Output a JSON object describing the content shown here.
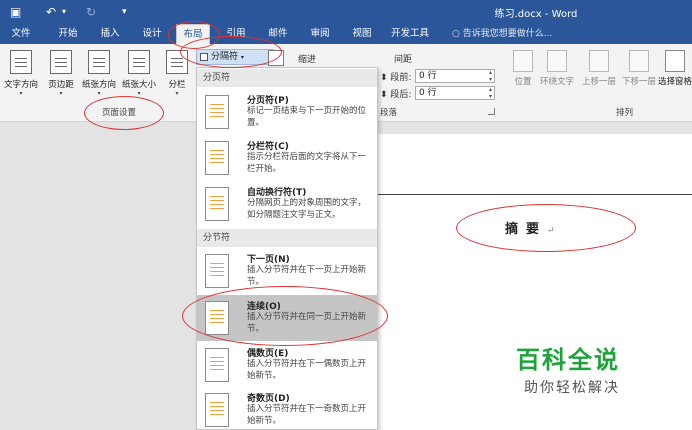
{
  "titlebar": {
    "save_icon": "save-icon",
    "undo_icon": "undo-icon",
    "redo_icon": "redo-icon",
    "customize_icon": "customize-icon",
    "title": "练习.docx - Word"
  },
  "tabs": [
    "文件",
    "开始",
    "插入",
    "设计",
    "布局",
    "引用",
    "邮件",
    "审阅",
    "视图",
    "开发工具"
  ],
  "active_tab": "布局",
  "tell_me": "告诉我您想要做什么...",
  "ribbon": {
    "page_setup": {
      "text_direction": "文字方向",
      "margins": "页边距",
      "orientation": "纸张方向",
      "size": "纸张大小",
      "columns": "分栏",
      "group_label": "页面设置"
    },
    "breaks_label": "分隔符",
    "indent_label": "缩进",
    "spacing": {
      "label": "间距",
      "before_label": "段前:",
      "before_value": "0 行",
      "after_label": "段后:",
      "after_value": "0 行"
    },
    "paragraph_group": "段落",
    "arrange": {
      "position": "位置",
      "wrap_text": "环绕文字",
      "bring_forward": "上移一层",
      "send_backward": "下移一层",
      "selection_pane": "选择窗格",
      "group_label": "排列"
    }
  },
  "dropdown": {
    "page_breaks_header": "分页符",
    "section_breaks_header": "分节符",
    "items": [
      {
        "title": "分页符(P)",
        "desc": "标记一页结束与下一页开始的位置。"
      },
      {
        "title": "分栏符(C)",
        "desc": "指示分栏符后面的文字将从下一栏开始。"
      },
      {
        "title": "自动换行符(T)",
        "desc": "分隔网页上的对象周围的文字，如分隔题注文字与正文。"
      },
      {
        "title": "下一页(N)",
        "desc": "插入分节符并在下一页上开始新节。"
      },
      {
        "title": "连续(O)",
        "desc": "插入分节符并在同一页上开始新节。"
      },
      {
        "title": "偶数页(E)",
        "desc": "插入分节符并在下一偶数页上开始新节。"
      },
      {
        "title": "奇数页(D)",
        "desc": "插入分节符并在下一奇数页上开始新节。"
      }
    ]
  },
  "document": {
    "abstract_text": "摘要",
    "paragraph_mark": "↵"
  },
  "watermark": {
    "line1": "百科全说",
    "line2": "助你轻松解决"
  },
  "colors": {
    "title_bar": "#2b579a",
    "ribbon_bg": "#f3f3f3",
    "annotation": "#e03030",
    "watermark_green": "#1ea33b"
  }
}
